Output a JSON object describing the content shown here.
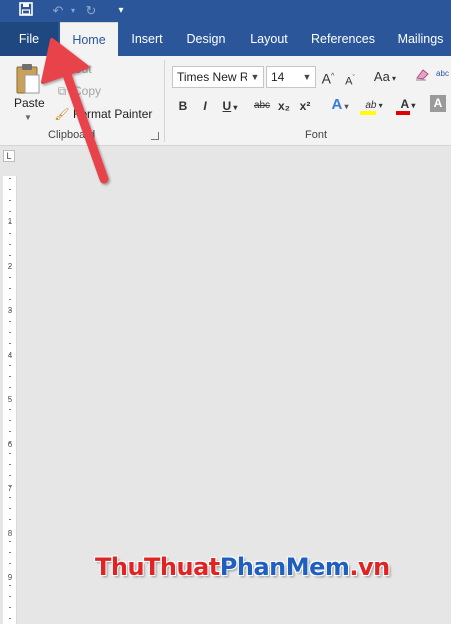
{
  "quick_access": {
    "save_icon": "save-icon",
    "undo_icon": "undo-icon",
    "redo_icon": "redo-icon",
    "customize_icon": "customize-qat-icon"
  },
  "tabs": [
    {
      "label": "File"
    },
    {
      "label": "Home"
    },
    {
      "label": "Insert"
    },
    {
      "label": "Design"
    },
    {
      "label": "Layout"
    },
    {
      "label": "References"
    },
    {
      "label": "Mailings"
    }
  ],
  "clipboard": {
    "paste_label": "Paste",
    "cut_label": "Cut",
    "copy_label": "Copy",
    "format_painter_label": "Format Painter",
    "group_label": "Clipboard"
  },
  "font": {
    "font_name": "Times New R",
    "font_size": "14",
    "group_label": "Font",
    "change_case_label": "Aa",
    "grow_label": "A",
    "shrink_label": "A",
    "bold_label": "B",
    "italic_label": "I",
    "underline_label": "U",
    "strike_label": "abc",
    "subscript_label": "x₂",
    "superscript_label": "x²",
    "effects_label": "A",
    "highlight_label": "ab",
    "font_color_label": "A",
    "shade_label": "A",
    "clear_label": "abc"
  },
  "ruler": {
    "corner_label": "L",
    "numbers": [
      "1",
      "2",
      "3",
      "4",
      "5",
      "6",
      "7",
      "8",
      "9"
    ]
  },
  "watermark": {
    "part1": "ThuThuat",
    "part2": "PhanMem",
    "part3": ".vn"
  },
  "colors": {
    "ribbon_blue": "#2b579a",
    "file_tab": "#1f4880",
    "arrow_red": "#e8434b",
    "highlight_yellow": "#ffff00",
    "font_color_red": "#e00000"
  }
}
